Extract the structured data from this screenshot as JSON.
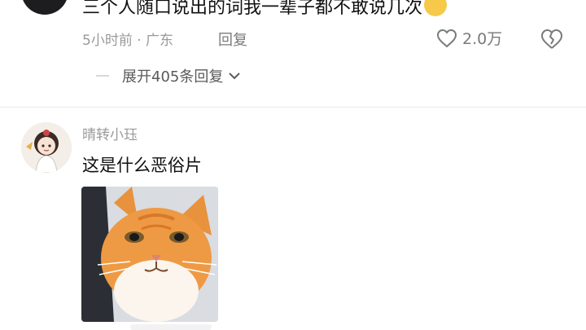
{
  "comment1": {
    "text": "三个人随口说出的词我一辈子都不敢说几次",
    "emoji": "grin-emoji",
    "time_location": "5小时前 · 广东",
    "reply_label": "回复",
    "like_count": "2.0万"
  },
  "expand_replies": {
    "label": "展开405条回复"
  },
  "comment2": {
    "username": "晴转小珏",
    "text": "这是什么恶俗片",
    "image": "orange-cat-meme-image"
  },
  "colors": {
    "meta_gray": "#9a9a9a",
    "text_dark": "#111111",
    "emoji_yellow": "#f7c948",
    "cat_orange": "#e8923e"
  }
}
